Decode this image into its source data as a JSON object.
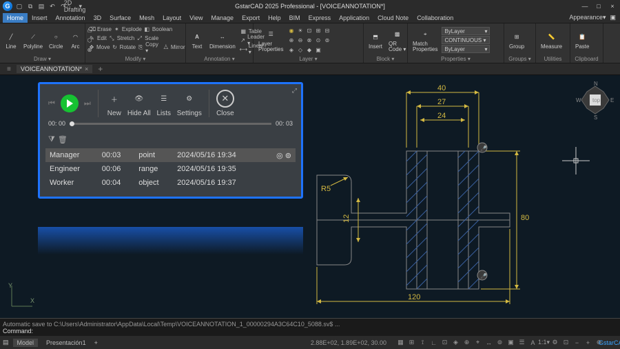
{
  "title": "GstarCAD 2025 Professional - [VOICEANNOTATION*]",
  "workspace": "2D Drafting",
  "appearance_label": "Appearance",
  "menutabs": [
    "Home",
    "Insert",
    "Annotation",
    "3D",
    "Surface",
    "Mesh",
    "Layout",
    "View",
    "Manage",
    "Export",
    "Help",
    "BIM",
    "Express",
    "Application",
    "Cloud Note",
    "Collaboration"
  ],
  "menutab_active": 0,
  "ribbon": {
    "draw": {
      "label": "Draw ▾",
      "items": [
        "Line",
        "Polyline",
        "Circle",
        "Arc"
      ]
    },
    "modify": {
      "label": "Modify ▾",
      "rows": [
        [
          "Erase",
          "Explode",
          "Boolean"
        ],
        [
          "Edit",
          "Stretch",
          "Scale"
        ],
        [
          "Move",
          "Rotate",
          "Copy ▾",
          "Mirror"
        ]
      ]
    },
    "annotation": {
      "label": "Annotation ▾",
      "main": [
        "Text",
        "Dimension"
      ],
      "side": [
        "Table",
        "Leader ▾",
        "Linear ▾"
      ]
    },
    "layer": {
      "label": "Layer ▾",
      "btn": "Layer\nProperties"
    },
    "block": {
      "label": "Block ▾",
      "items": [
        "Insert",
        "QR\nCode ▾"
      ]
    },
    "properties": {
      "label": "Properties ▾",
      "match": "Match\nProperties",
      "rows": [
        "ByLayer",
        "CONTINUOUS ▾",
        "ByLayer"
      ]
    },
    "group": {
      "label": "Groups ▾",
      "btn": "Group"
    },
    "utilities": {
      "label": "Utilities",
      "btn": "Measure"
    },
    "clipboard": {
      "label": "Clipboard",
      "btn": "Paste"
    }
  },
  "doc_start": "≡",
  "doc_tab": "VOICEANNOTATION*",
  "voice": {
    "time_start": "00: 00",
    "time_end": "00: 03",
    "actions": [
      "New",
      "Hide All",
      "Lists",
      "Settings",
      "Close"
    ],
    "rows": [
      {
        "role": "Manager",
        "dur": "00:03",
        "type": "point",
        "ts": "2024/05/16 19:34",
        "sel": true
      },
      {
        "role": "Engineer",
        "dur": "00:06",
        "type": "range",
        "ts": "2024/05/16 19:35",
        "sel": false
      },
      {
        "role": "Worker",
        "dur": "00:04",
        "type": "object",
        "ts": "2024/05/16 19:37",
        "sel": false
      }
    ]
  },
  "dims": {
    "d40": "40",
    "d27": "27",
    "d24": "24",
    "d12": "12",
    "d80": "80",
    "d120": "120",
    "r5": "R5"
  },
  "compass": {
    "n": "N",
    "s": "S",
    "e": "E",
    "w": "W",
    "top": "top"
  },
  "ucs": {
    "x": "X",
    "y": "Y"
  },
  "cmd": {
    "l1": "Automatic save to C:\\Users\\Administrator\\AppData\\Local\\Temp\\VOICEANNOTATION_1_00000294A3C64C10_5088.sv$ ...",
    "l2": "Command:"
  },
  "status": {
    "model": "Model",
    "tab2": "Presentación1",
    "coords": "2.88E+02, 1.89E+02, 30.00",
    "brand": "GstarCAD"
  }
}
